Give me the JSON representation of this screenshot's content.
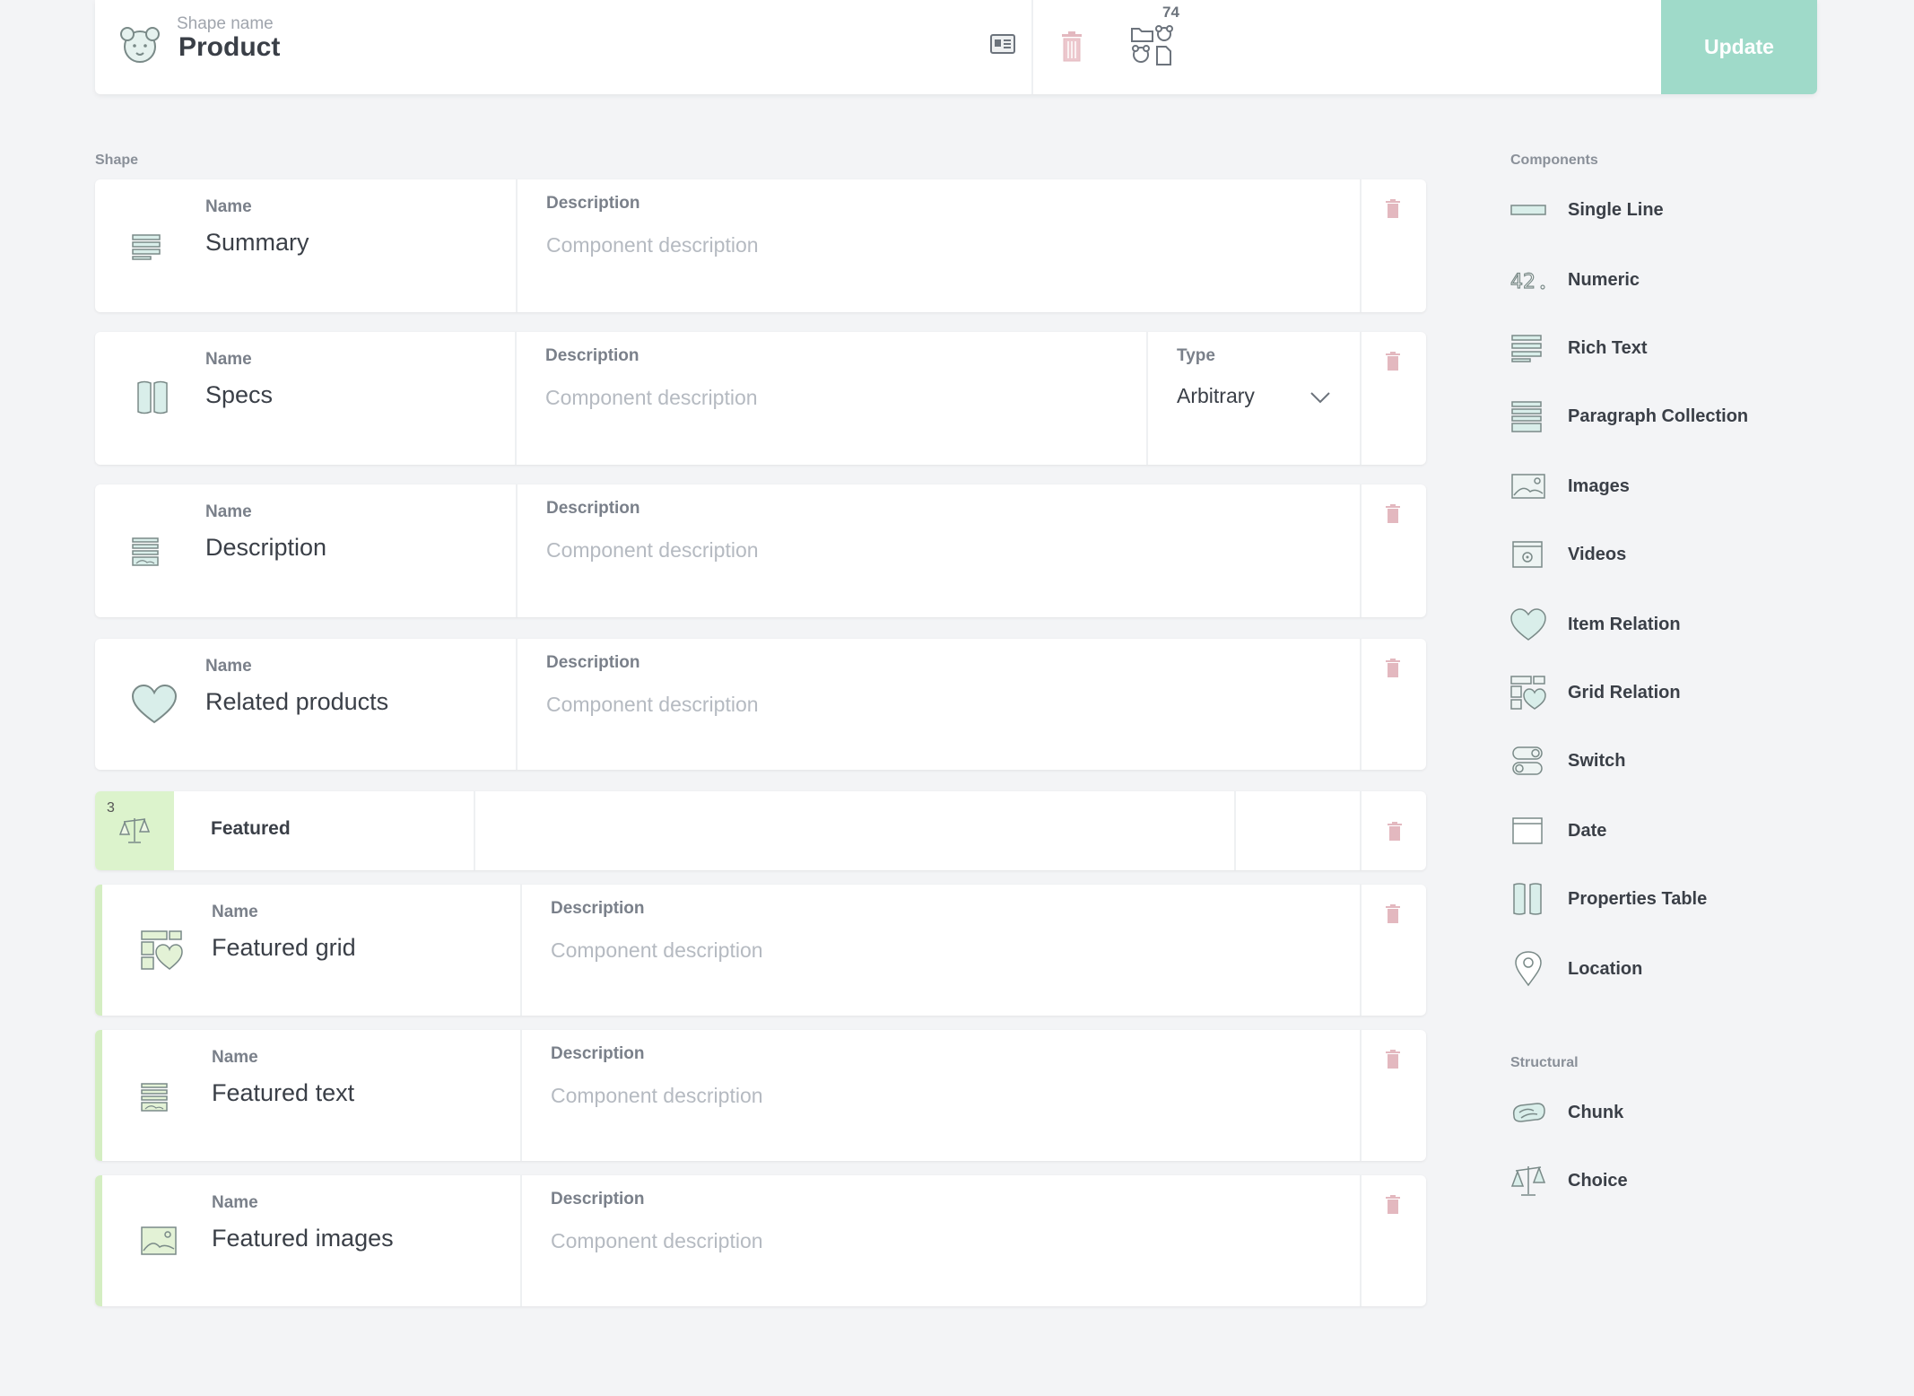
{
  "header": {
    "shape_name_label": "Shape name",
    "shape_name": "Product",
    "catalogue_count": "74",
    "update_label": "Update"
  },
  "shape": {
    "section_label": "Shape",
    "name_label": "Name",
    "description_label": "Description",
    "description_placeholder": "Component description",
    "type_label": "Type",
    "components": [
      {
        "name": "Summary",
        "icon": "rich-text-icon"
      },
      {
        "name": "Specs",
        "icon": "properties-table-icon",
        "type": "Arbitrary"
      },
      {
        "name": "Description",
        "icon": "paragraph-collection-icon"
      },
      {
        "name": "Related products",
        "icon": "item-relation-icon"
      }
    ],
    "choice": {
      "count": "3",
      "name": "Featured",
      "icon": "choice-icon",
      "children": [
        {
          "name": "Featured grid",
          "icon": "grid-relation-icon"
        },
        {
          "name": "Featured text",
          "icon": "paragraph-collection-icon"
        },
        {
          "name": "Featured images",
          "icon": "images-icon"
        }
      ]
    }
  },
  "sidebar": {
    "components_label": "Components",
    "components": [
      {
        "label": "Single Line",
        "icon": "single-line-icon"
      },
      {
        "label": "Numeric",
        "icon": "numeric-icon"
      },
      {
        "label": "Rich Text",
        "icon": "rich-text-icon"
      },
      {
        "label": "Paragraph Collection",
        "icon": "paragraph-collection-icon"
      },
      {
        "label": "Images",
        "icon": "images-icon"
      },
      {
        "label": "Videos",
        "icon": "videos-icon"
      },
      {
        "label": "Item Relation",
        "icon": "item-relation-icon"
      },
      {
        "label": "Grid Relation",
        "icon": "grid-relation-icon"
      },
      {
        "label": "Switch",
        "icon": "switch-icon"
      },
      {
        "label": "Date",
        "icon": "date-icon"
      },
      {
        "label": "Properties Table",
        "icon": "properties-table-icon"
      },
      {
        "label": "Location",
        "icon": "location-icon"
      }
    ],
    "structural_label": "Structural",
    "structural": [
      {
        "label": "Chunk",
        "icon": "chunk-icon"
      },
      {
        "label": "Choice",
        "icon": "choice-icon"
      }
    ]
  },
  "colors": {
    "accent": "#9fdac9",
    "icon_stroke": "#7a8a88",
    "icon_fill": "#d9eeea",
    "trash": "#e3b8bf",
    "choice_bg": "#dcf3cc"
  },
  "icon_names": {
    "shape_logo": "bear-icon",
    "card": "card-icon",
    "trash": "trash-icon",
    "catalogue": "catalogue-icon",
    "chevron": "chevron-down-icon"
  }
}
